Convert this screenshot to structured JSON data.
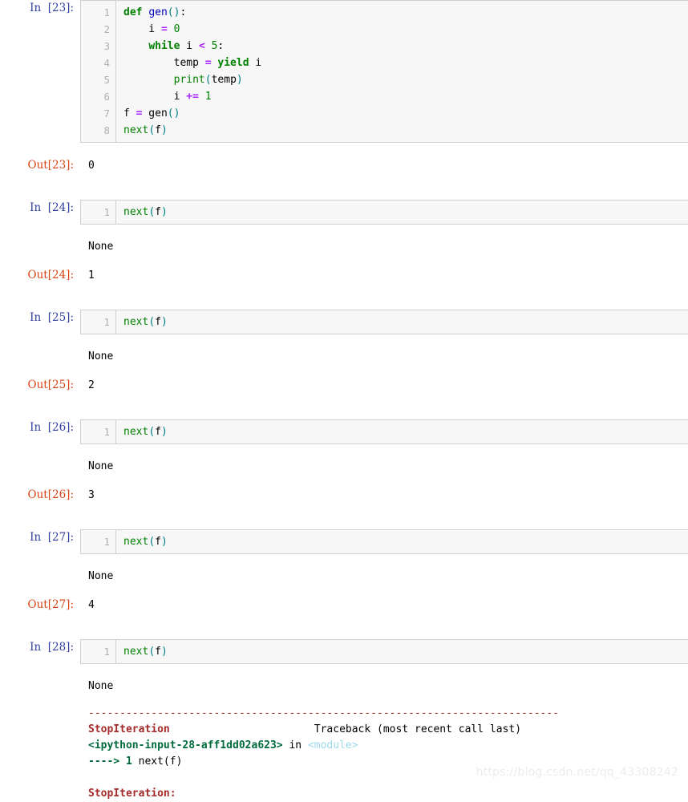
{
  "notebook": {
    "watermark": "https://blog.csdn.net/qq_43308242",
    "in_label": "In",
    "out_label": "Out",
    "colors": {
      "keyword": "#008000",
      "function": "#0000C0",
      "builtin": "#008000",
      "number": "#008000",
      "operator": "#AA22FF",
      "paren": "#008080",
      "in_prompt": "#303F9F",
      "out_prompt": "#D84315",
      "cell_background": "#f7f7f7",
      "cell_border": "#cfcfcf",
      "gutter_number": "#b0b0b0",
      "traceback_error": "#A52A2A",
      "traceback_file": "#006B3C",
      "traceback_module": "#9CD9EA",
      "page_background": "#ffffff"
    }
  },
  "cells": [
    {
      "prompt_in": "In  [23]:",
      "execution_count": 23,
      "line_numbers": [
        "1",
        "2",
        "3",
        "4",
        "5",
        "6",
        "7",
        "8"
      ],
      "source_lines": [
        "def gen():",
        "    i = 0",
        "    while i < 5:",
        "        temp = yield i",
        "        print(temp)",
        "        i += 1",
        "f = gen()",
        "next(f)"
      ],
      "stdout": null,
      "prompt_out": "Out[23]:",
      "result": "0"
    },
    {
      "prompt_in": "In  [24]:",
      "execution_count": 24,
      "line_numbers": [
        "1"
      ],
      "source_lines": [
        "next(f)"
      ],
      "stdout": "None",
      "prompt_out": "Out[24]:",
      "result": "1"
    },
    {
      "prompt_in": "In  [25]:",
      "execution_count": 25,
      "line_numbers": [
        "1"
      ],
      "source_lines": [
        "next(f)"
      ],
      "stdout": "None",
      "prompt_out": "Out[25]:",
      "result": "2"
    },
    {
      "prompt_in": "In  [26]:",
      "execution_count": 26,
      "line_numbers": [
        "1"
      ],
      "source_lines": [
        "next(f)"
      ],
      "stdout": "None",
      "prompt_out": "Out[26]:",
      "result": "3"
    },
    {
      "prompt_in": "In  [27]:",
      "execution_count": 27,
      "line_numbers": [
        "1"
      ],
      "source_lines": [
        "next(f)"
      ],
      "stdout": "None",
      "prompt_out": "Out[27]:",
      "result": "4"
    },
    {
      "prompt_in": "In  [28]:",
      "execution_count": 28,
      "line_numbers": [
        "1"
      ],
      "source_lines": [
        "next(f)"
      ],
      "stdout": "None",
      "prompt_out": null,
      "result": null
    }
  ],
  "traceback": {
    "separator": "---------------------------------------------------------------------------",
    "exception_name": "StopIteration",
    "header_right": "Traceback (most recent call last)",
    "frame_file": "<ipython-input-28-aff1dd02a623>",
    "frame_in": " in ",
    "frame_scope": "<module>",
    "arrow": "----> ",
    "arrow_lineno": "1",
    "arrow_code": " next(f)",
    "final_line": "StopIteration:"
  }
}
